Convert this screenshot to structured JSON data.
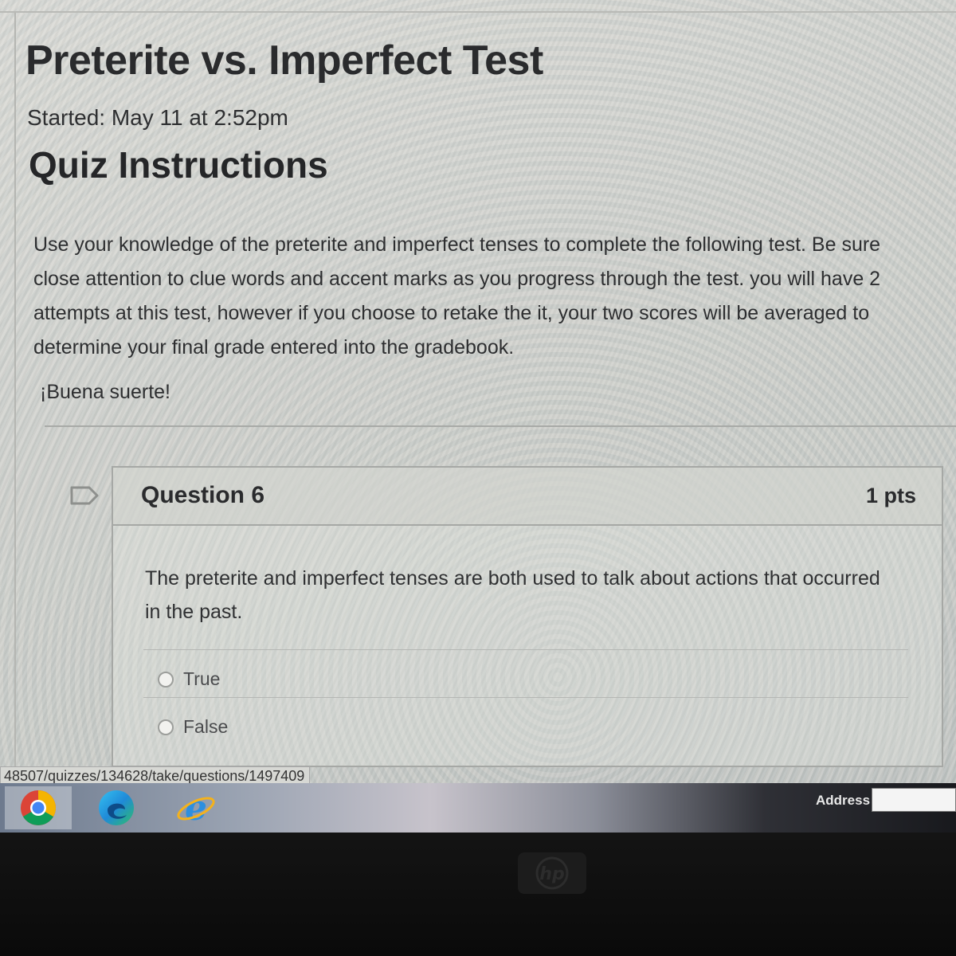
{
  "page": {
    "title": "Preterite vs. Imperfect Test",
    "started": "Started: May 11 at 2:52pm",
    "instructions_heading": "Quiz Instructions",
    "instructions_lines": [
      "Use your knowledge of the preterite and imperfect tenses to complete the following test.  Be sure",
      "close attention to clue words and accent marks as you progress through the test.  you will have 2",
      "attempts at this test, however if you choose to retake the it, your two scores will be averaged to",
      "determine your final grade entered into the gradebook."
    ],
    "closing": "¡Buena suerte!"
  },
  "question": {
    "title": "Question 6",
    "points": "1 pts",
    "text_lines": [
      "The preterite and imperfect tenses are both used to talk about actions that occurred",
      "in the past."
    ],
    "answers": [
      "True",
      "False"
    ],
    "flag_icon": "flag-outline-icon"
  },
  "status_bar": {
    "url": "48507/quizzes/134628/take/questions/1497409"
  },
  "taskbar": {
    "apps": [
      "chrome-icon",
      "edge-icon",
      "internet-explorer-icon"
    ],
    "address_label": "Address"
  },
  "bezel": {
    "logo": "hp"
  },
  "colors": {
    "text_dark": "#2a2b2d",
    "card_border": "#a6a8a5",
    "screen_bg": "#d2d3ce"
  }
}
